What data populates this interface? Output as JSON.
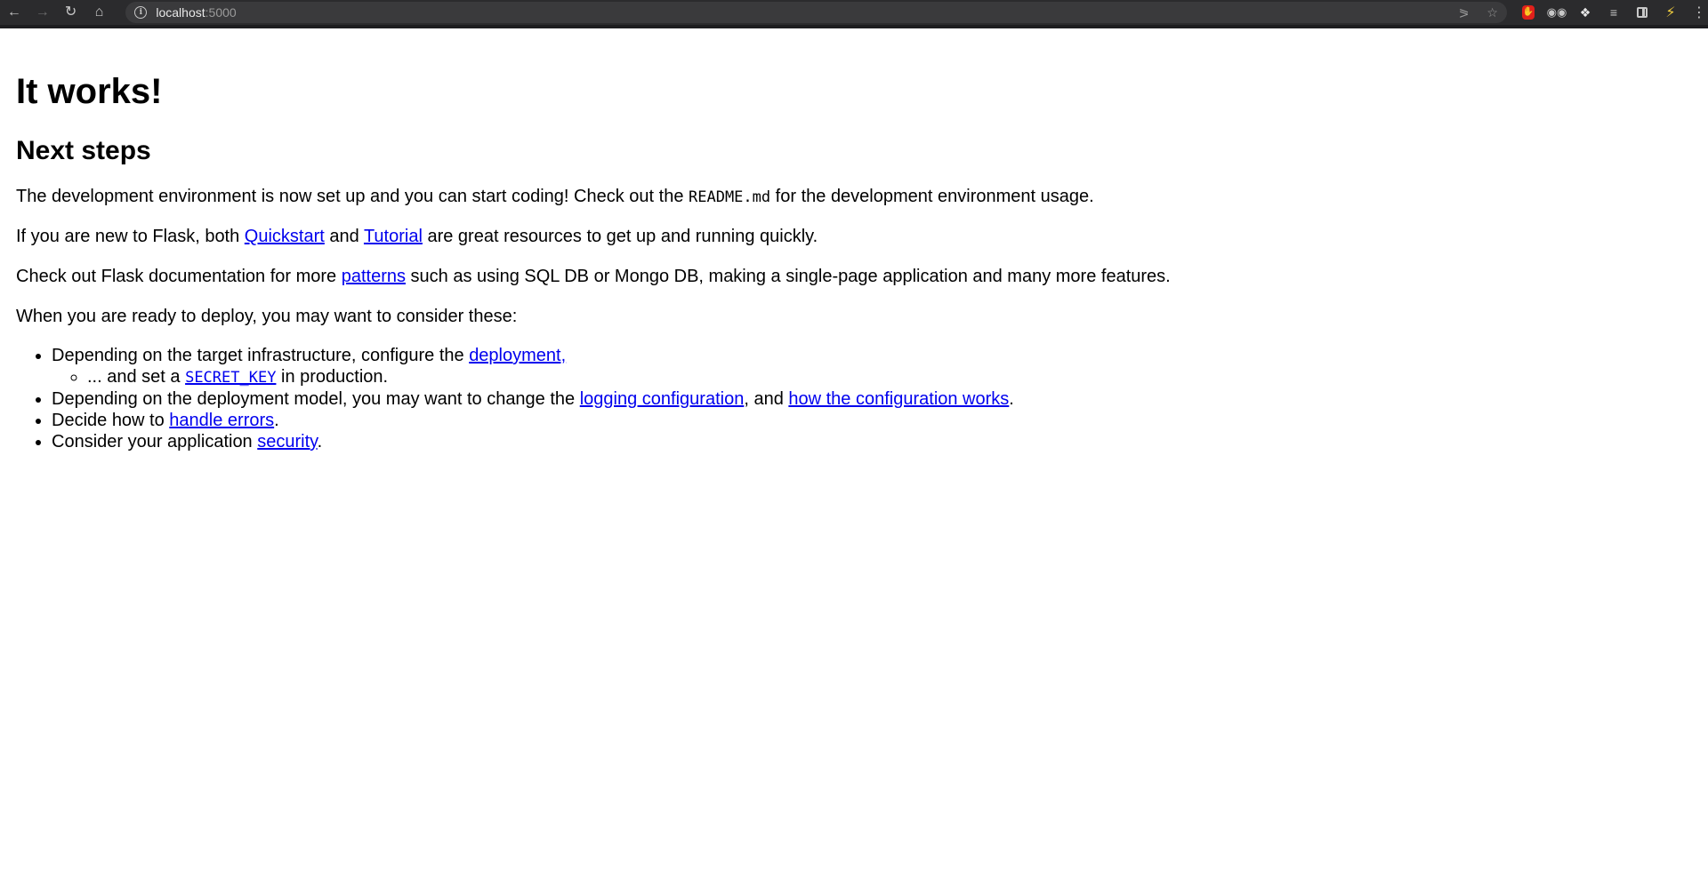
{
  "browser": {
    "url_host": "localhost",
    "url_port": ":5000"
  },
  "page": {
    "title": "It works!",
    "subtitle": "Next steps",
    "para1": {
      "before": "The development environment is now set up and you can start coding! Check out the ",
      "code": "README.md",
      "after": " for the development environment usage."
    },
    "para2": {
      "before": "If you are new to Flask, both ",
      "link1": "Quickstart",
      "middle": " and ",
      "link2": "Tutorial",
      "after": " are great resources to get up and running quickly."
    },
    "para3": {
      "before": "Check out Flask documentation for more ",
      "link": "patterns",
      "after": " such as using SQL DB or Mongo DB, making a single-page application and many more features."
    },
    "para4": "When you are ready to deploy, you may want to consider these:",
    "list": {
      "item1": {
        "before": "Depending on the target infrastructure, configure the ",
        "link": "deployment,"
      },
      "item1_sub": {
        "before": "... and set a ",
        "code": "SECRET_KEY",
        "after": " in production."
      },
      "item2": {
        "before": "Depending on the deployment model, you may want to change the ",
        "link1": "logging configuration",
        "middle": ", and ",
        "link2": "how the configuration works",
        "after": "."
      },
      "item3": {
        "before": "Decide how to ",
        "link": "handle errors",
        "after": "."
      },
      "item4": {
        "before": "Consider your application ",
        "link": "security",
        "after": "."
      }
    }
  }
}
